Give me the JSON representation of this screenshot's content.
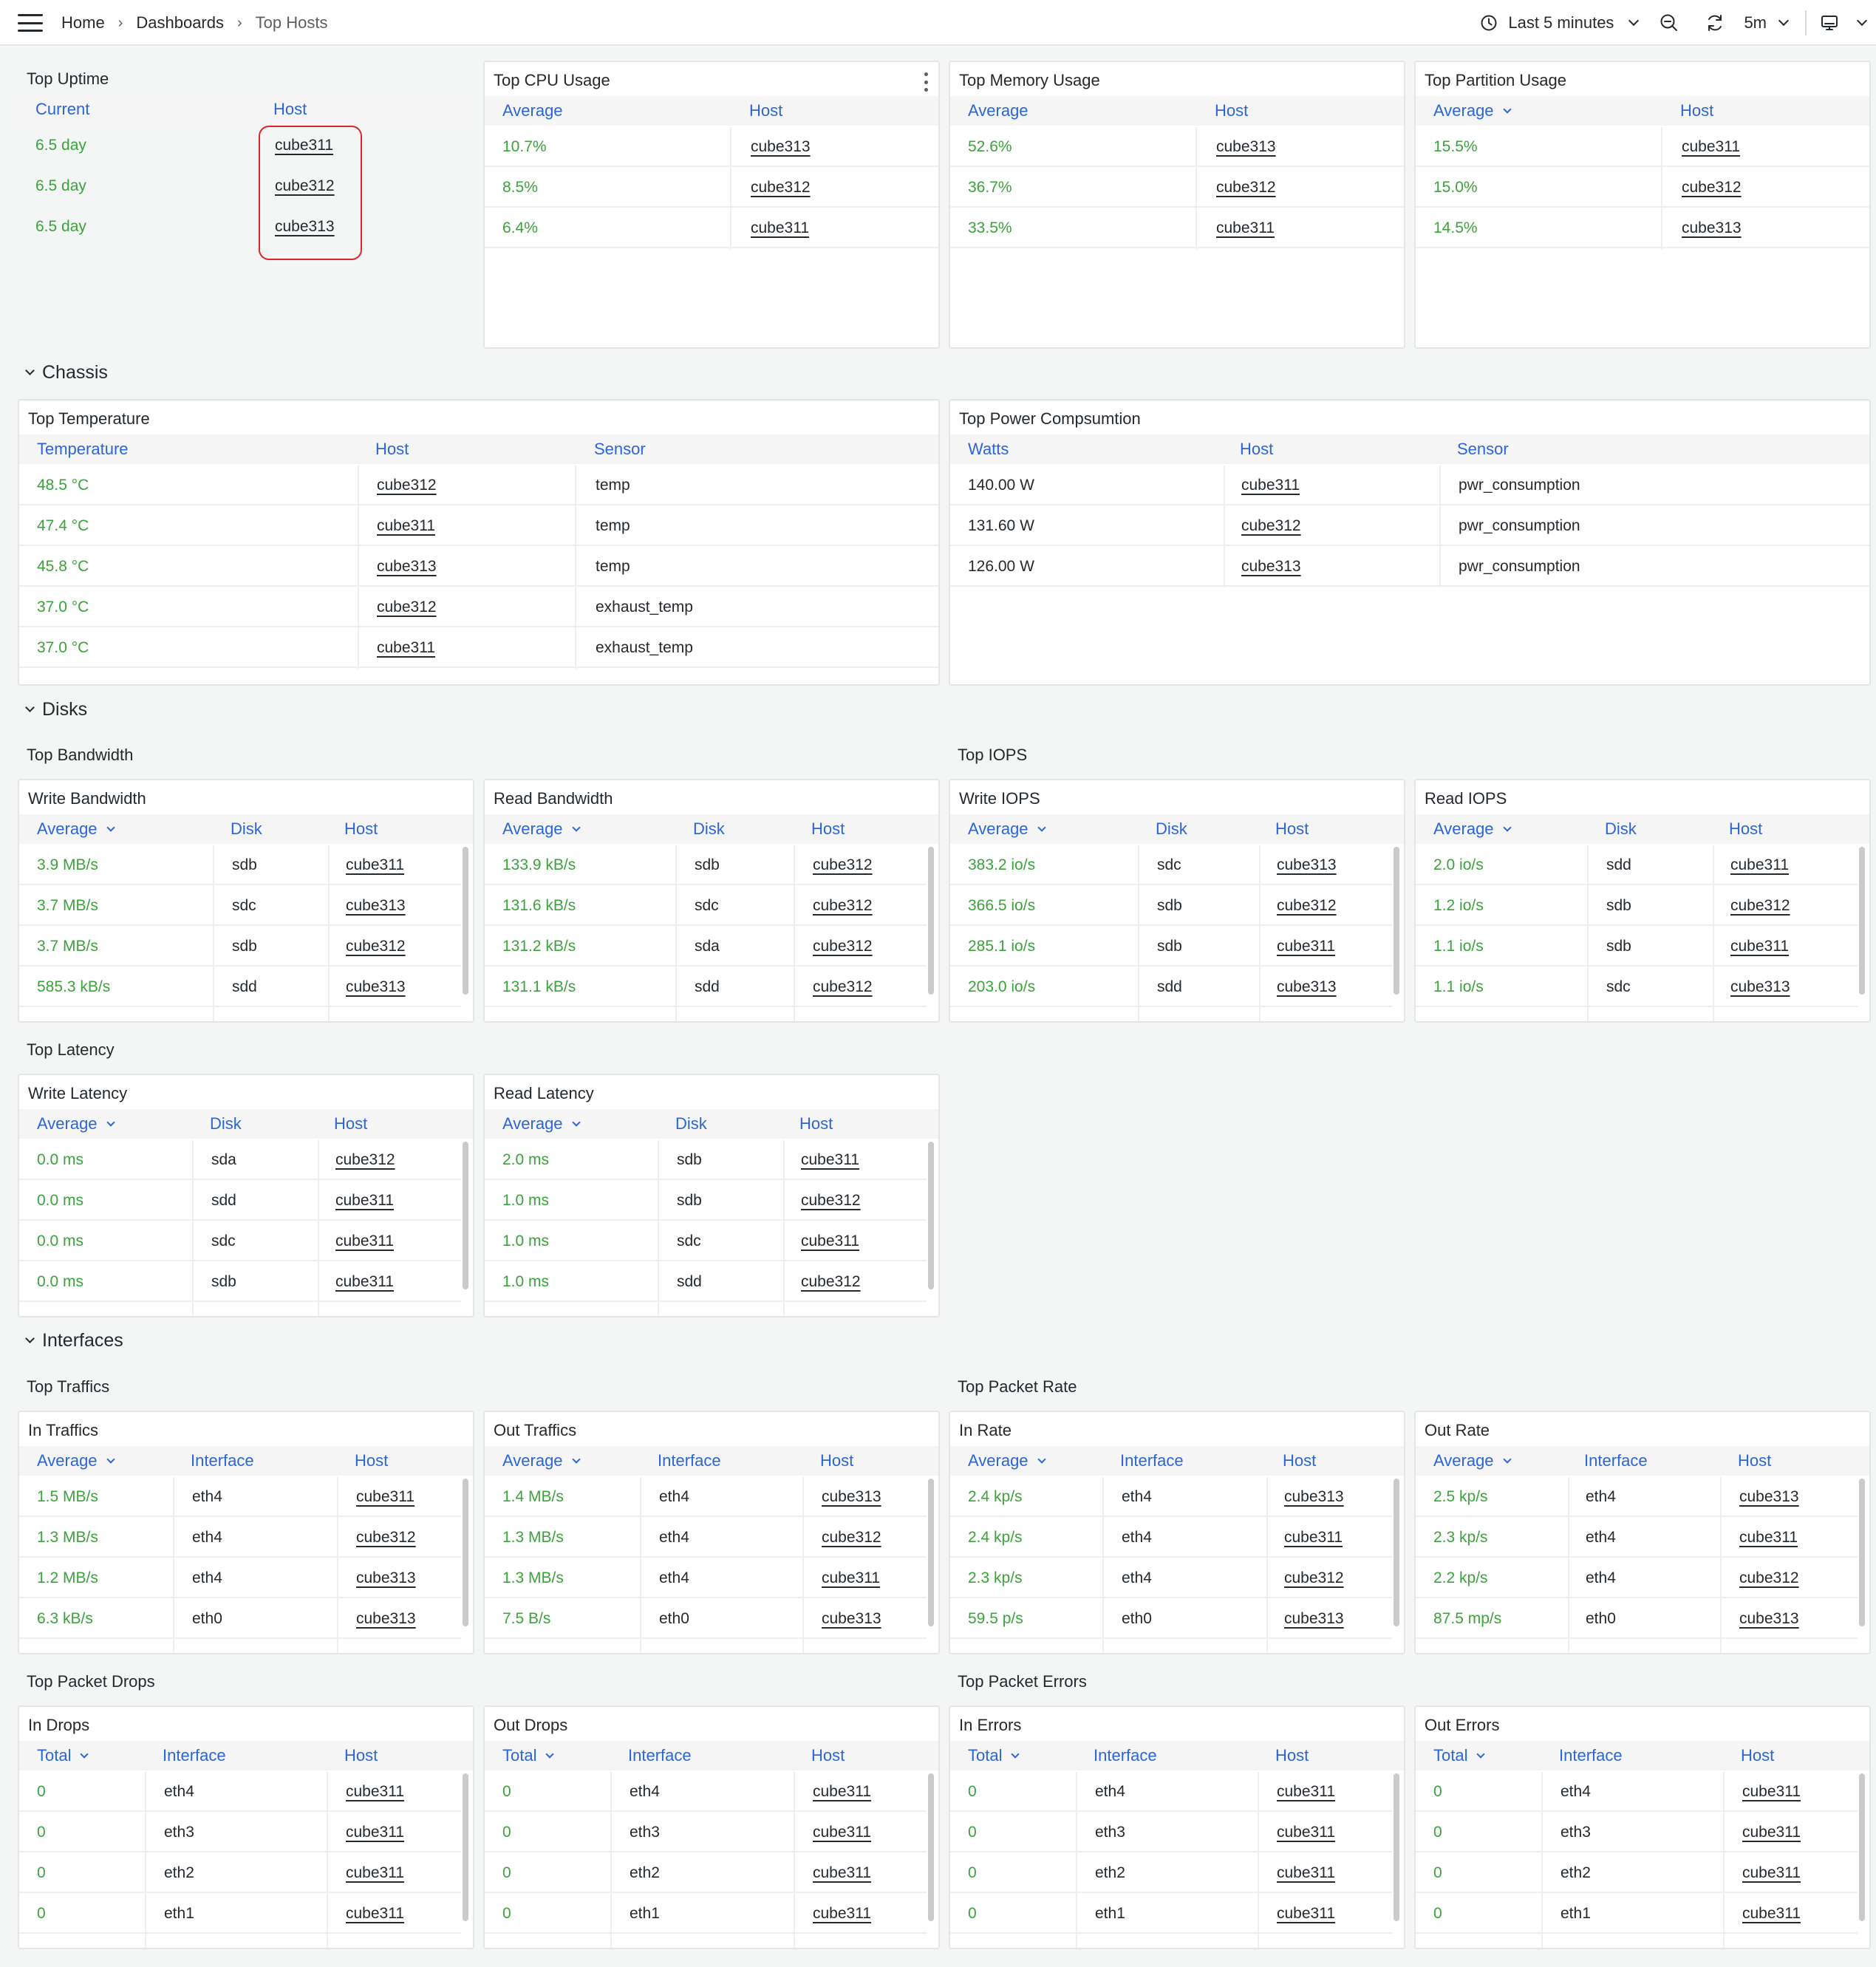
{
  "breadcrumb": {
    "home": "Home",
    "dashboards": "Dashboards",
    "current": "Top Hosts"
  },
  "toolbar": {
    "time_range": "Last 5 minutes",
    "refresh_interval": "5m"
  },
  "sections": {
    "chassis": "Chassis",
    "disks": "Disks",
    "interfaces": "Interfaces"
  },
  "groups": {
    "top_bandwidth": "Top Bandwidth",
    "top_iops": "Top IOPS",
    "top_latency": "Top Latency",
    "top_traffics": "Top Traffics",
    "top_packet_rate": "Top Packet Rate",
    "top_packet_drops": "Top Packet Drops",
    "top_packet_errors": "Top Packet Errors"
  },
  "colors": {
    "value_green": "#3aa33a",
    "header_blue": "#2c66d6",
    "highlight_red": "#e0242a"
  },
  "panels": [
    {
      "id": "uptime",
      "title": "Top Uptime",
      "columns": [
        "Current",
        "Host"
      ],
      "sorted": false,
      "rows": [
        [
          "6.5 day",
          "cube311"
        ],
        [
          "6.5 day",
          "cube312"
        ],
        [
          "6.5 day",
          "cube313"
        ]
      ]
    },
    {
      "id": "cpu",
      "title": "Top CPU Usage",
      "columns": [
        "Average",
        "Host"
      ],
      "sorted": false,
      "rows": [
        [
          "10.7%",
          "cube313"
        ],
        [
          "8.5%",
          "cube312"
        ],
        [
          "6.4%",
          "cube311"
        ]
      ]
    },
    {
      "id": "memory",
      "title": "Top Memory Usage",
      "columns": [
        "Average",
        "Host"
      ],
      "sorted": false,
      "rows": [
        [
          "52.6%",
          "cube313"
        ],
        [
          "36.7%",
          "cube312"
        ],
        [
          "33.5%",
          "cube311"
        ]
      ]
    },
    {
      "id": "partition",
      "title": "Top Partition Usage",
      "columns": [
        "Average",
        "Host"
      ],
      "sorted": true,
      "rows": [
        [
          "15.5%",
          "cube311"
        ],
        [
          "15.0%",
          "cube312"
        ],
        [
          "14.5%",
          "cube313"
        ]
      ]
    },
    {
      "id": "temperature",
      "title": "Top Temperature",
      "columns": [
        "Temperature",
        "Host",
        "Sensor"
      ],
      "sorted": false,
      "rows": [
        [
          "48.5 °C",
          "cube312",
          "temp"
        ],
        [
          "47.4 °C",
          "cube311",
          "temp"
        ],
        [
          "45.8 °C",
          "cube313",
          "temp"
        ],
        [
          "37.0 °C",
          "cube312",
          "exhaust_temp"
        ],
        [
          "37.0 °C",
          "cube311",
          "exhaust_temp"
        ]
      ]
    },
    {
      "id": "power",
      "title": "Top Power Compsumtion",
      "columns": [
        "Watts",
        "Host",
        "Sensor"
      ],
      "sorted": false,
      "rows": [
        [
          "140.00 W",
          "cube311",
          "pwr_consumption"
        ],
        [
          "131.60 W",
          "cube312",
          "pwr_consumption"
        ],
        [
          "126.00 W",
          "cube313",
          "pwr_consumption"
        ]
      ]
    },
    {
      "id": "write_bw",
      "title": "Write Bandwidth",
      "columns": [
        "Average",
        "Disk",
        "Host"
      ],
      "sorted": true,
      "rows": [
        [
          "3.9 MB/s",
          "sdb",
          "cube311"
        ],
        [
          "3.7 MB/s",
          "sdc",
          "cube313"
        ],
        [
          "3.7 MB/s",
          "sdb",
          "cube312"
        ],
        [
          "585.3 kB/s",
          "sdd",
          "cube313"
        ]
      ]
    },
    {
      "id": "read_bw",
      "title": "Read Bandwidth",
      "columns": [
        "Average",
        "Disk",
        "Host"
      ],
      "sorted": true,
      "rows": [
        [
          "133.9 kB/s",
          "sdb",
          "cube312"
        ],
        [
          "131.6 kB/s",
          "sdc",
          "cube312"
        ],
        [
          "131.2 kB/s",
          "sda",
          "cube312"
        ],
        [
          "131.1 kB/s",
          "sdd",
          "cube312"
        ]
      ]
    },
    {
      "id": "write_iops",
      "title": "Write IOPS",
      "columns": [
        "Average",
        "Disk",
        "Host"
      ],
      "sorted": true,
      "rows": [
        [
          "383.2 io/s",
          "sdc",
          "cube313"
        ],
        [
          "366.5 io/s",
          "sdb",
          "cube312"
        ],
        [
          "285.1 io/s",
          "sdb",
          "cube311"
        ],
        [
          "203.0 io/s",
          "sdd",
          "cube313"
        ]
      ]
    },
    {
      "id": "read_iops",
      "title": "Read IOPS",
      "columns": [
        "Average",
        "Disk",
        "Host"
      ],
      "sorted": true,
      "rows": [
        [
          "2.0 io/s",
          "sdd",
          "cube311"
        ],
        [
          "1.2 io/s",
          "sdb",
          "cube312"
        ],
        [
          "1.1 io/s",
          "sdb",
          "cube311"
        ],
        [
          "1.1 io/s",
          "sdc",
          "cube313"
        ]
      ]
    },
    {
      "id": "write_lat",
      "title": "Write Latency",
      "columns": [
        "Average",
        "Disk",
        "Host"
      ],
      "sorted": true,
      "rows": [
        [
          "0.0 ms",
          "sda",
          "cube312"
        ],
        [
          "0.0 ms",
          "sdd",
          "cube311"
        ],
        [
          "0.0 ms",
          "sdc",
          "cube311"
        ],
        [
          "0.0 ms",
          "sdb",
          "cube311"
        ]
      ]
    },
    {
      "id": "read_lat",
      "title": "Read Latency",
      "columns": [
        "Average",
        "Disk",
        "Host"
      ],
      "sorted": true,
      "rows": [
        [
          "2.0 ms",
          "sdb",
          "cube311"
        ],
        [
          "1.0 ms",
          "sdb",
          "cube312"
        ],
        [
          "1.0 ms",
          "sdc",
          "cube311"
        ],
        [
          "1.0 ms",
          "sdd",
          "cube312"
        ]
      ]
    },
    {
      "id": "in_traffic",
      "title": "In Traffics",
      "columns": [
        "Average",
        "Interface",
        "Host"
      ],
      "sorted": true,
      "rows": [
        [
          "1.5 MB/s",
          "eth4",
          "cube311"
        ],
        [
          "1.3 MB/s",
          "eth4",
          "cube312"
        ],
        [
          "1.2 MB/s",
          "eth4",
          "cube313"
        ],
        [
          "6.3 kB/s",
          "eth0",
          "cube313"
        ]
      ]
    },
    {
      "id": "out_traffic",
      "title": "Out Traffics",
      "columns": [
        "Average",
        "Interface",
        "Host"
      ],
      "sorted": true,
      "rows": [
        [
          "1.4 MB/s",
          "eth4",
          "cube313"
        ],
        [
          "1.3 MB/s",
          "eth4",
          "cube312"
        ],
        [
          "1.3 MB/s",
          "eth4",
          "cube311"
        ],
        [
          "7.5 B/s",
          "eth0",
          "cube313"
        ]
      ]
    },
    {
      "id": "in_rate",
      "title": "In Rate",
      "columns": [
        "Average",
        "Interface",
        "Host"
      ],
      "sorted": true,
      "rows": [
        [
          "2.4 kp/s",
          "eth4",
          "cube313"
        ],
        [
          "2.4 kp/s",
          "eth4",
          "cube311"
        ],
        [
          "2.3 kp/s",
          "eth4",
          "cube312"
        ],
        [
          "59.5 p/s",
          "eth0",
          "cube313"
        ]
      ]
    },
    {
      "id": "out_rate",
      "title": "Out Rate",
      "columns": [
        "Average",
        "Interface",
        "Host"
      ],
      "sorted": true,
      "rows": [
        [
          "2.5 kp/s",
          "eth4",
          "cube313"
        ],
        [
          "2.3 kp/s",
          "eth4",
          "cube311"
        ],
        [
          "2.2 kp/s",
          "eth4",
          "cube312"
        ],
        [
          "87.5 mp/s",
          "eth0",
          "cube313"
        ]
      ]
    },
    {
      "id": "in_drops",
      "title": "In Drops",
      "columns": [
        "Total",
        "Interface",
        "Host"
      ],
      "sorted": true,
      "rows": [
        [
          "0",
          "eth4",
          "cube311"
        ],
        [
          "0",
          "eth3",
          "cube311"
        ],
        [
          "0",
          "eth2",
          "cube311"
        ],
        [
          "0",
          "eth1",
          "cube311"
        ]
      ]
    },
    {
      "id": "out_drops",
      "title": "Out Drops",
      "columns": [
        "Total",
        "Interface",
        "Host"
      ],
      "sorted": true,
      "rows": [
        [
          "0",
          "eth4",
          "cube311"
        ],
        [
          "0",
          "eth3",
          "cube311"
        ],
        [
          "0",
          "eth2",
          "cube311"
        ],
        [
          "0",
          "eth1",
          "cube311"
        ]
      ]
    },
    {
      "id": "in_errors",
      "title": "In Errors",
      "columns": [
        "Total",
        "Interface",
        "Host"
      ],
      "sorted": true,
      "rows": [
        [
          "0",
          "eth4",
          "cube311"
        ],
        [
          "0",
          "eth3",
          "cube311"
        ],
        [
          "0",
          "eth2",
          "cube311"
        ],
        [
          "0",
          "eth1",
          "cube311"
        ]
      ]
    },
    {
      "id": "out_errors",
      "title": "Out Errors",
      "columns": [
        "Total",
        "Interface",
        "Host"
      ],
      "sorted": true,
      "rows": [
        [
          "0",
          "eth4",
          "cube311"
        ],
        [
          "0",
          "eth3",
          "cube311"
        ],
        [
          "0",
          "eth2",
          "cube311"
        ],
        [
          "0",
          "eth1",
          "cube311"
        ]
      ]
    }
  ]
}
